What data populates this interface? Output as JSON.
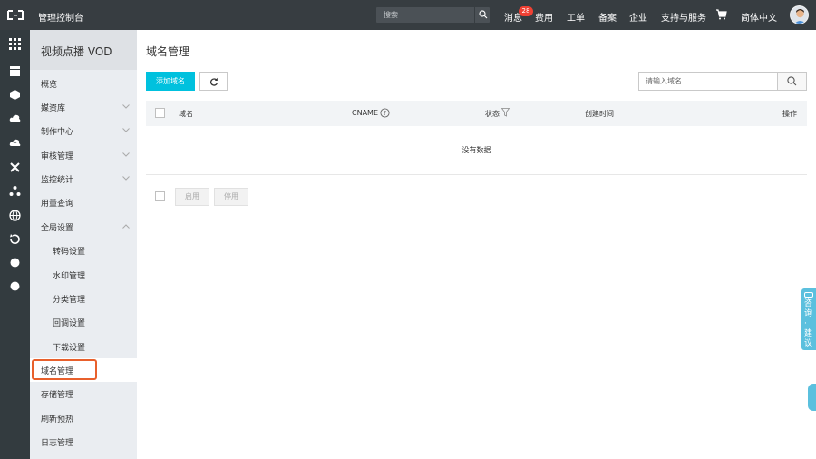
{
  "topbar": {
    "title": "管理控制台",
    "search_placeholder": "搜索",
    "nav": [
      {
        "label": "消息",
        "badge": "28"
      },
      {
        "label": "费用"
      },
      {
        "label": "工单"
      },
      {
        "label": "备案"
      },
      {
        "label": "企业"
      },
      {
        "label": "支持与服务"
      },
      {
        "label": "简体中文"
      }
    ]
  },
  "rail": {
    "icons": [
      "grid-icon",
      "list-icon",
      "ecs-icon",
      "cloud-icon",
      "cloud-upload-icon",
      "x-icon",
      "cluster-icon",
      "globe-icon",
      "refresh-icon",
      "circle-icon",
      "circle-icon"
    ]
  },
  "sidebar": {
    "title": "视频点播 VOD",
    "items": [
      {
        "label": "概览",
        "level": 1,
        "expandable": false
      },
      {
        "label": "媒资库",
        "level": 1,
        "expandable": true
      },
      {
        "label": "制作中心",
        "level": 1,
        "expandable": true
      },
      {
        "label": "审核管理",
        "level": 1,
        "expandable": true
      },
      {
        "label": "监控统计",
        "level": 1,
        "expandable": true
      },
      {
        "label": "用量查询",
        "level": 1,
        "expandable": false
      },
      {
        "label": "全局设置",
        "level": 1,
        "expandable": true,
        "expanded": true
      },
      {
        "label": "转码设置",
        "level": 2
      },
      {
        "label": "水印管理",
        "level": 2
      },
      {
        "label": "分类管理",
        "level": 2
      },
      {
        "label": "回调设置",
        "level": 2
      },
      {
        "label": "下载设置",
        "level": 2
      },
      {
        "label": "域名管理",
        "level": 1,
        "active": true
      },
      {
        "label": "存储管理",
        "level": 1
      },
      {
        "label": "刷新预热",
        "level": 1
      },
      {
        "label": "日志管理",
        "level": 1
      }
    ]
  },
  "main": {
    "title": "域名管理",
    "add_button": "添加域名",
    "search_placeholder": "请输入域名",
    "columns": [
      "域名",
      "CNAME",
      "状态",
      "创建时间",
      "操作"
    ],
    "empty_text": "没有数据",
    "enable_button": "启用",
    "disable_button": "停用"
  },
  "feedback": {
    "label": "咨询·建议"
  },
  "colors": {
    "topbar": "#373d41",
    "rail": "#333b3f",
    "sidebar": "#eaedf1",
    "primary": "#00c1de",
    "highlight": "#e8602c",
    "badge": "#f04134"
  }
}
